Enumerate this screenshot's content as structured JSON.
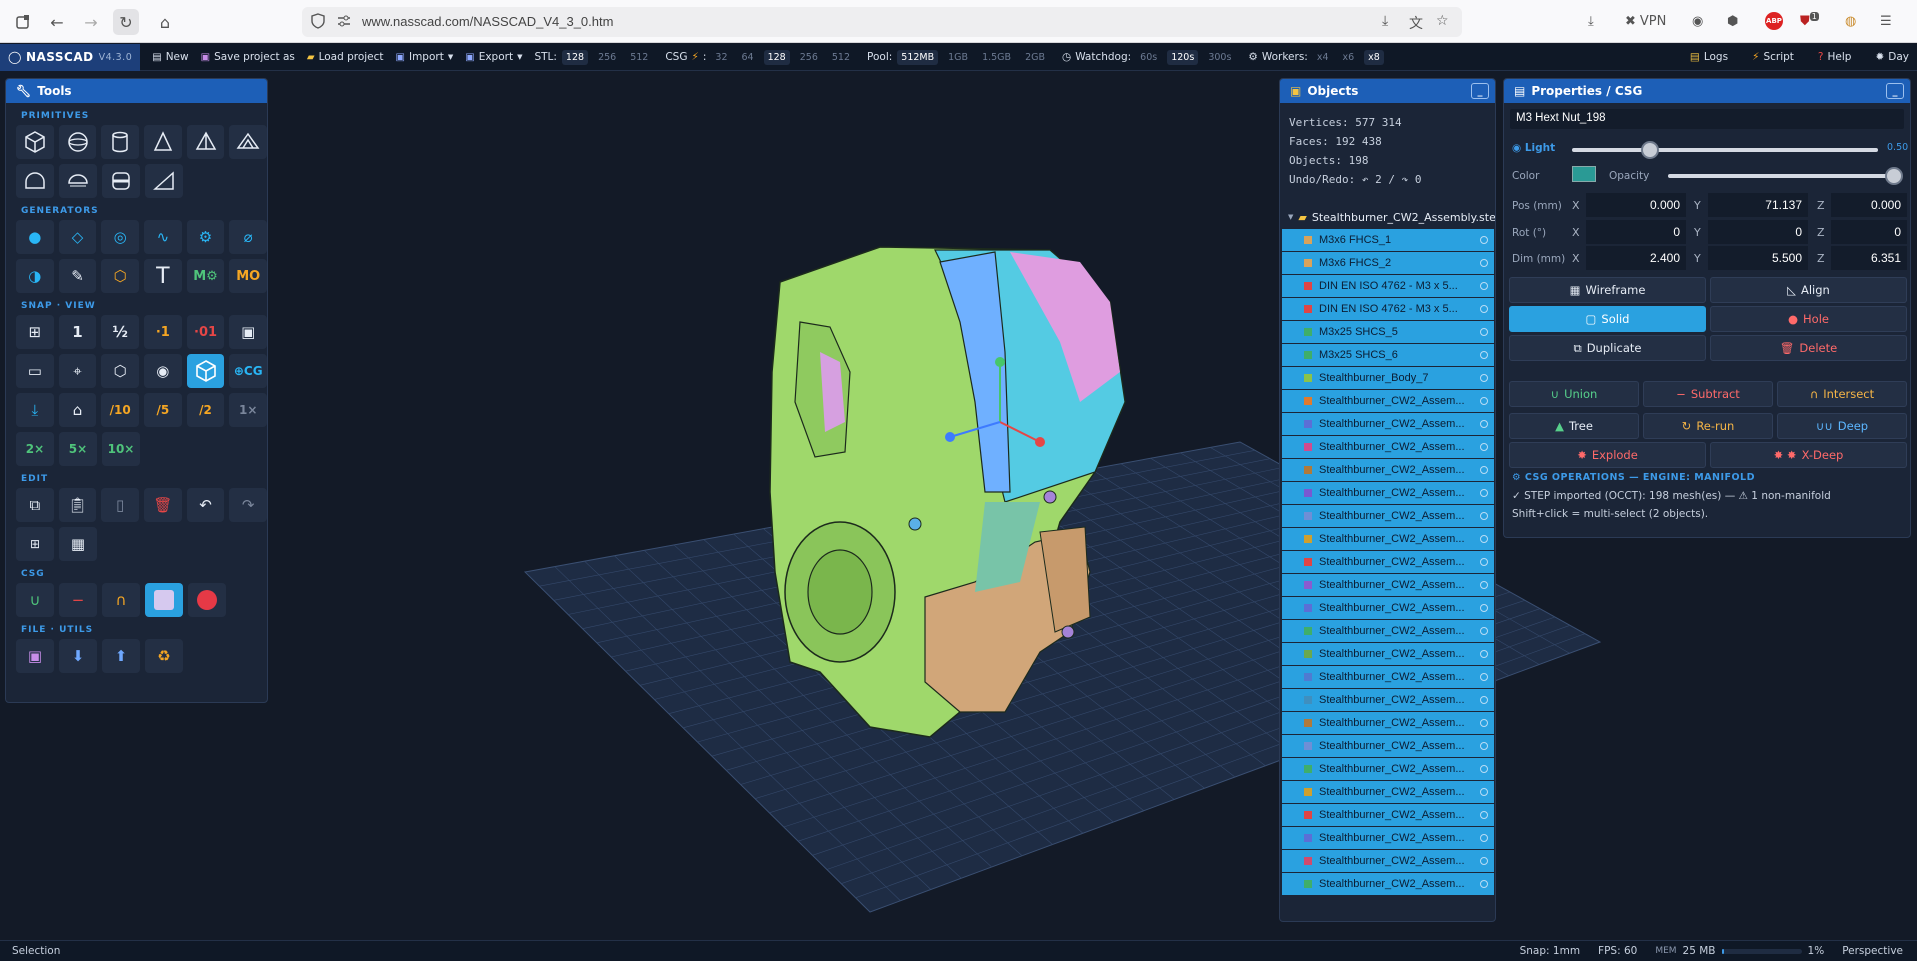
{
  "browser": {
    "url": "www.nasscad.com/NASSCAD_V4_3_0.htm",
    "vpn_label": "VPN",
    "ext_badge_text": "ABP",
    "notif_count": "1"
  },
  "toolbar": {
    "brand": "NASSCAD",
    "version": "V4.3.0",
    "new_label": "New",
    "save_as_label": "Save project as",
    "load_label": "Load project",
    "import_label": "Import",
    "export_label": "Export",
    "stl_label": "STL:",
    "stl_options": [
      "128",
      "256",
      "512"
    ],
    "stl_selected": "128",
    "csg_label": "CSG",
    "csg_options": [
      "32",
      "64",
      "128",
      "256",
      "512"
    ],
    "csg_selected": "128",
    "pool_label": "Pool:",
    "pool_options": [
      "512MB",
      "1GB",
      "1.5GB",
      "2GB"
    ],
    "pool_selected": "512MB",
    "watchdog_label": "Watchdog:",
    "watchdog_options": [
      "60s",
      "120s",
      "300s"
    ],
    "watchdog_selected": "120s",
    "workers_label": "Workers:",
    "workers_options": [
      "x4",
      "x6",
      "x8"
    ],
    "workers_selected": "x8",
    "logs_label": "Logs",
    "script_label": "Script",
    "help_label": "Help",
    "day_label": "Day"
  },
  "tools_panel": {
    "title": "Tools",
    "sections": {
      "primitives": "PRIMITIVES",
      "generators": "GENERATORS",
      "snap_view": "SNAP · VIEW",
      "edit": "EDIT",
      "csg": "CSG",
      "file_utils": "FILE · UTILS"
    },
    "gen_text": "T",
    "gen_m_gear": "M⚙",
    "gen_mo": "MO",
    "snap_1": "1",
    "snap_half": "½",
    "snap_dot1": "·1",
    "snap_dot01": "·01",
    "snap_cg": "⊕CG",
    "snap_10": "/10",
    "snap_5": "/5",
    "snap_2": "/2",
    "snap_1x": "1×",
    "snap_2x": "2×",
    "snap_5x": "5×",
    "snap_10x": "10×"
  },
  "objects_panel": {
    "title": "Objects",
    "vertices": "Vertices: 577 314",
    "faces": "Faces: 192 438",
    "objects": "Objects: 198",
    "undo_redo": "Undo/Redo: ↶ 2 / ↷ 0",
    "root": "Stealthburner_CW2_Assembly.step",
    "items": [
      {
        "label": "M3x6 FHCS_1",
        "color": "#d9a35a"
      },
      {
        "label": "M3x6 FHCS_2",
        "color": "#d9a35a"
      },
      {
        "label": "DIN EN ISO 4762 - M3 x 5...",
        "color": "#e04545"
      },
      {
        "label": "DIN EN ISO 4762 - M3 x 5...",
        "color": "#e04545"
      },
      {
        "label": "M3x25 SHCS_5",
        "color": "#3fae6a"
      },
      {
        "label": "M3x25 SHCS_6",
        "color": "#3fae6a"
      },
      {
        "label": "Stealthburner_Body_7",
        "color": "#8bc34a"
      },
      {
        "label": "Stealthburner_CW2_Assem...",
        "color": "#e07b2e"
      },
      {
        "label": "Stealthburner_CW2_Assem...",
        "color": "#5b6fd6"
      },
      {
        "label": "Stealthburner_CW2_Assem...",
        "color": "#d04b8e"
      },
      {
        "label": "Stealthburner_CW2_Assem...",
        "color": "#b07a3a"
      },
      {
        "label": "Stealthburner_CW2_Assem...",
        "color": "#7a59d1"
      },
      {
        "label": "Stealthburner_CW2_Assem...",
        "color": "#6e8fd6"
      },
      {
        "label": "Stealthburner_CW2_Assem...",
        "color": "#cfa02e"
      },
      {
        "label": "Stealthburner_CW2_Assem...",
        "color": "#e04545"
      },
      {
        "label": "Stealthburner_CW2_Assem...",
        "color": "#8a5cd0"
      },
      {
        "label": "Stealthburner_CW2_Assem...",
        "color": "#5b6fd6"
      },
      {
        "label": "Stealthburner_CW2_Assem...",
        "color": "#3fae6a"
      },
      {
        "label": "Stealthburner_CW2_Assem...",
        "color": "#6aa84f"
      },
      {
        "label": "Stealthburner_CW2_Assem...",
        "color": "#4f7bd1"
      },
      {
        "label": "Stealthburner_CW2_Assem...",
        "color": "#3f8fbf"
      },
      {
        "label": "Stealthburner_CW2_Assem...",
        "color": "#b07a3a"
      },
      {
        "label": "Stealthburner_CW2_Assem...",
        "color": "#6e8fd6"
      },
      {
        "label": "Stealthburner_CW2_Assem...",
        "color": "#3fae6a"
      },
      {
        "label": "Stealthburner_CW2_Assem...",
        "color": "#cfa02e"
      },
      {
        "label": "Stealthburner_CW2_Assem...",
        "color": "#e04545"
      },
      {
        "label": "Stealthburner_CW2_Assem...",
        "color": "#5b6fd6"
      },
      {
        "label": "Stealthburner_CW2_Assem...",
        "color": "#d04b6e"
      },
      {
        "label": "Stealthburner_CW2_Assem...",
        "color": "#3fae6a"
      }
    ]
  },
  "props_panel": {
    "title": "Properties / CSG",
    "name": "M3 Hext Nut_198",
    "light_label": "Light",
    "light_value": "0.50",
    "color_label": "Color",
    "color_value": "#2a9a95",
    "opacity_label": "Opacity",
    "opacity_value": 1.0,
    "pos_label": "Pos (mm)",
    "rot_label": "Rot (°)",
    "dim_label": "Dim (mm)",
    "ax_x": "X",
    "ax_y": "Y",
    "ax_z": "Z",
    "pos": [
      "0.000",
      "71.137",
      "0.000"
    ],
    "rot": [
      "0",
      "0",
      "0"
    ],
    "dim": [
      "2.400",
      "5.500",
      "6.351"
    ],
    "wireframe": "Wireframe",
    "align": "Align",
    "solid": "Solid",
    "hole": "Hole",
    "duplicate": "Duplicate",
    "delete": "Delete",
    "union": "Union",
    "subtract": "Subtract",
    "intersect": "Intersect",
    "tree": "Tree",
    "rerun": "Re-run",
    "deep": "Deep",
    "explode": "Explode",
    "xdeep": "X-Deep",
    "csg_header": "⚙ CSG OPERATIONS — ENGINE: MANIFOLD",
    "csg_line1": "✓ STEP imported (OCCT): 198 mesh(es) — ⚠ 1 non-manifold",
    "csg_line2": "Shift+click = multi-select (2 objects)."
  },
  "status": {
    "left": "Selection",
    "snap": "Snap: 1mm",
    "fps": "FPS: 60",
    "mem_label": "MEM",
    "mem_value": "25 MB",
    "mem_fraction": 0.01,
    "percent": "1%",
    "projection": "Perspective"
  }
}
